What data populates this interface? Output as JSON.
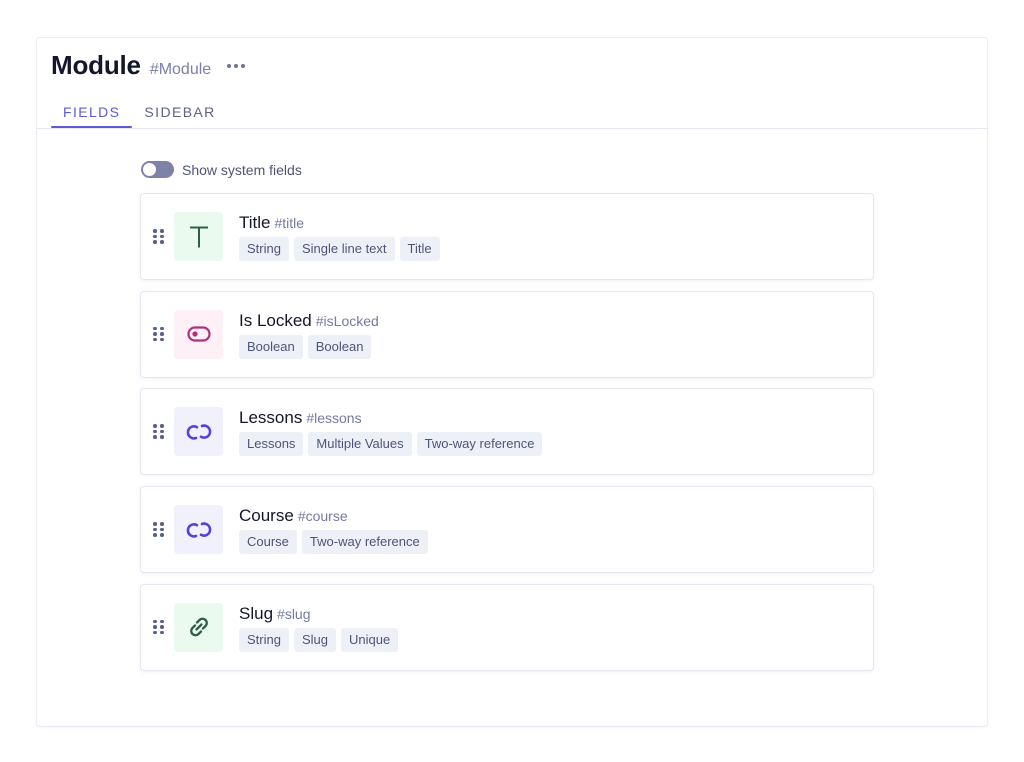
{
  "header": {
    "title": "Module",
    "api_id": "#Module",
    "more_icon": "more-horizontal-icon"
  },
  "tabs": [
    {
      "label": "FIELDS",
      "active": true
    },
    {
      "label": "SIDEBAR",
      "active": false
    }
  ],
  "system_fields_toggle": {
    "label": "Show system fields",
    "checked": false
  },
  "fields": [
    {
      "name": "Title",
      "api_id": "#title",
      "icon": "text-icon",
      "icon_bg": "#ebfaef",
      "icon_color": "#2f5e46",
      "tags": [
        "String",
        "Single line text",
        "Title"
      ]
    },
    {
      "name": "Is Locked",
      "api_id": "#isLocked",
      "icon": "toggle-icon",
      "icon_bg": "#fdf0f6",
      "icon_color": "#b0307a",
      "tags": [
        "Boolean",
        "Boolean"
      ]
    },
    {
      "name": "Lessons",
      "api_id": "#lessons",
      "icon": "reference-icon",
      "icon_bg": "#f1f0fd",
      "icon_color": "#5b3fd6",
      "tags": [
        "Lessons",
        "Multiple Values",
        "Two-way reference"
      ]
    },
    {
      "name": "Course",
      "api_id": "#course",
      "icon": "reference-icon",
      "icon_bg": "#f1f0fd",
      "icon_color": "#5b3fd6",
      "tags": [
        "Course",
        "Two-way reference"
      ]
    },
    {
      "name": "Slug",
      "api_id": "#slug",
      "icon": "link-icon",
      "icon_bg": "#ebfaef",
      "icon_color": "#2f5e46",
      "tags": [
        "String",
        "Slug",
        "Unique"
      ]
    }
  ]
}
